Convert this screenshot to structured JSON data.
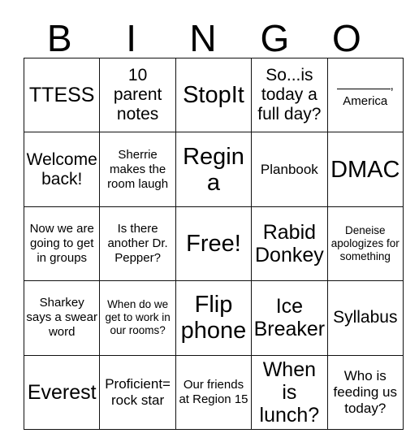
{
  "card": {
    "header_letters": [
      "B",
      "I",
      "N",
      "G",
      "O"
    ],
    "grid": [
      [
        {
          "text": "TTESS",
          "size": "lg"
        },
        {
          "text": "10 parent notes",
          "size": "md"
        },
        {
          "text": "StopIt",
          "size": "xl"
        },
        {
          "text": "So...is today a full day?",
          "size": "md"
        },
        {
          "type": "fill-in-blank",
          "blank": "________",
          "punctuation": ",",
          "text": "America",
          "size": "xs"
        }
      ],
      [
        {
          "text": "Welcome back!",
          "size": "md"
        },
        {
          "text": "Sherrie makes the room laugh",
          "size": "xs"
        },
        {
          "text": "Regina",
          "size": "xl"
        },
        {
          "text": "Planbook",
          "size": "sm"
        },
        {
          "text": "DMAC",
          "size": "xl"
        }
      ],
      [
        {
          "text": "Now we are going to get in groups",
          "size": "xs"
        },
        {
          "text": "Is there another Dr. Pepper?",
          "size": "xs"
        },
        {
          "text": "Free!",
          "size": "xl"
        },
        {
          "text": "Rabid Donkey",
          "size": "lg"
        },
        {
          "text": "Deneise apologizes for something",
          "size": "xxs"
        }
      ],
      [
        {
          "text": "Sharkey says a swear word",
          "size": "xs"
        },
        {
          "text": "When do we get to work in our rooms?",
          "size": "xxs"
        },
        {
          "text": "Flip phone",
          "size": "xl"
        },
        {
          "text": "Ice Breaker",
          "size": "lg"
        },
        {
          "text": "Syllabus",
          "size": "md"
        }
      ],
      [
        {
          "text": "Everest",
          "size": "lg"
        },
        {
          "text": "Proficient= rock star",
          "size": "sm"
        },
        {
          "text": "Our friends at Region 15",
          "size": "xs"
        },
        {
          "text": "When is lunch?",
          "size": "lg"
        },
        {
          "text": "Who is feeding us today?",
          "size": "sm"
        }
      ]
    ]
  }
}
